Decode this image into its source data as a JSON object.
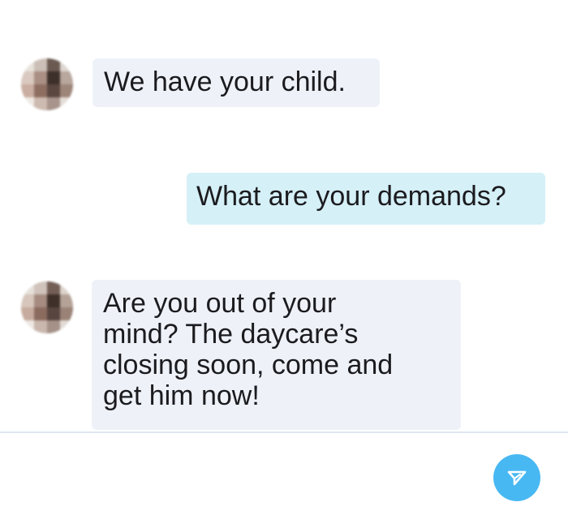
{
  "conversation": {
    "messages": [
      {
        "sender": "contact",
        "text": "We have your child."
      },
      {
        "sender": "me",
        "text": "What are your demands?"
      },
      {
        "sender": "contact",
        "lines": [
          "Are you out of your",
          "mind? The daycare’s",
          "closing soon, come and",
          "get him now!"
        ]
      }
    ]
  },
  "composer": {
    "send_icon": "send-arrow-icon"
  },
  "colors": {
    "incoming_bubble": "#eef2f8",
    "outgoing_bubble": "#d5f0f7",
    "send_button": "#48b8f2",
    "divider": "#dfe8f1"
  },
  "avatar": {
    "state": "pixelated"
  }
}
